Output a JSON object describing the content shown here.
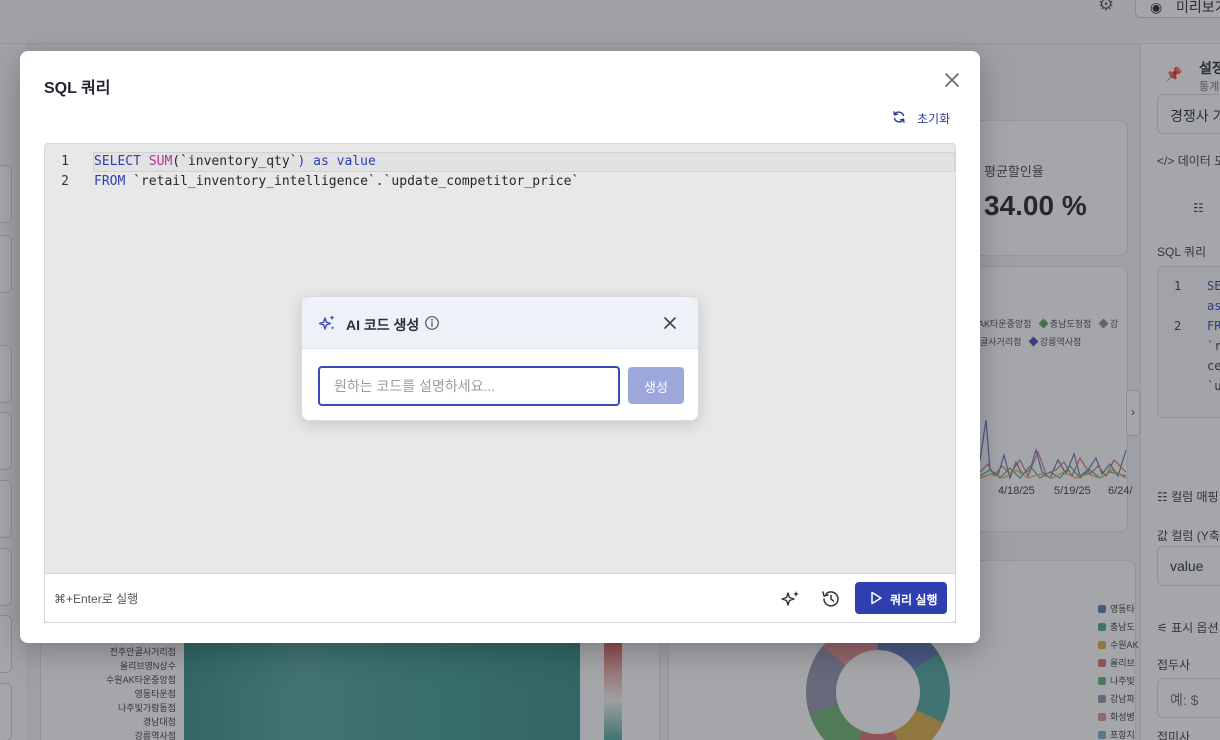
{
  "background": {
    "top_preview_label": "미리보기",
    "kpi": {
      "label": "평균할인율",
      "value": "34.00 %"
    },
    "line_legend": [
      "AK타운중앙점",
      "충남도청점",
      "강",
      "골사거리점",
      "강릉역사점"
    ],
    "axis_labels": [
      "4/18/25",
      "5/19/25",
      "6/24/"
    ],
    "heatmap_row_labels": [
      "전주안골사거리점",
      "올리브영N상수",
      "수원AK타운중앙점",
      "영동타운점",
      "나주빛가람동점",
      "경남대점",
      "강릉역사점"
    ],
    "donut_legend": [
      "영동타",
      "충남도",
      "수원AK",
      "올리브",
      "나주빛",
      "강남파",
      "화성병",
      "포항지"
    ],
    "colors": {
      "accent": "#2f3fb0",
      "teal": "#4aa39a"
    },
    "side_panel": {
      "title": "설정",
      "subtitle": "통계",
      "dropdown_value": "경쟁사 가",
      "data_model_label": "데이터 모",
      "sql_label": "SQL 쿼리",
      "code_lines": [
        "1",
        "SE",
        "as",
        "2",
        "FR",
        "`r",
        "ce",
        "`u"
      ],
      "column_mapping_label": "컬럼 매핑",
      "value_column_label": "값 컬럼 (Y축)",
      "value_column_value": "value",
      "display_options_label": "표시 옵션",
      "prefix_label": "접두사",
      "prefix_placeholder": "예: $",
      "suffix_label": "접미사"
    }
  },
  "modal": {
    "title": "SQL 쿼리",
    "reset_label": "초기화",
    "editor_lines": [
      {
        "num": "1",
        "tokens": [
          {
            "t": "SELECT ",
            "c": "kw"
          },
          {
            "t": "SUM",
            "c": "fn"
          },
          {
            "t": "(`inventory_qty`",
            "c": ""
          },
          {
            "t": ") as value",
            "c": "kw"
          }
        ]
      },
      {
        "num": "2",
        "tokens": [
          {
            "t": "FROM ",
            "c": "kw"
          },
          {
            "t": "`retail_inventory_intelligence`.`update_competitor_price`",
            "c": ""
          }
        ]
      }
    ],
    "footer_hint": "⌘+Enter로 실행",
    "run_label": "쿼리 실행"
  },
  "ai_popover": {
    "title": "AI 코드 생성",
    "input_placeholder": "원하는 코드를 설명하세요...",
    "input_value": "",
    "generate_label": "생성"
  }
}
